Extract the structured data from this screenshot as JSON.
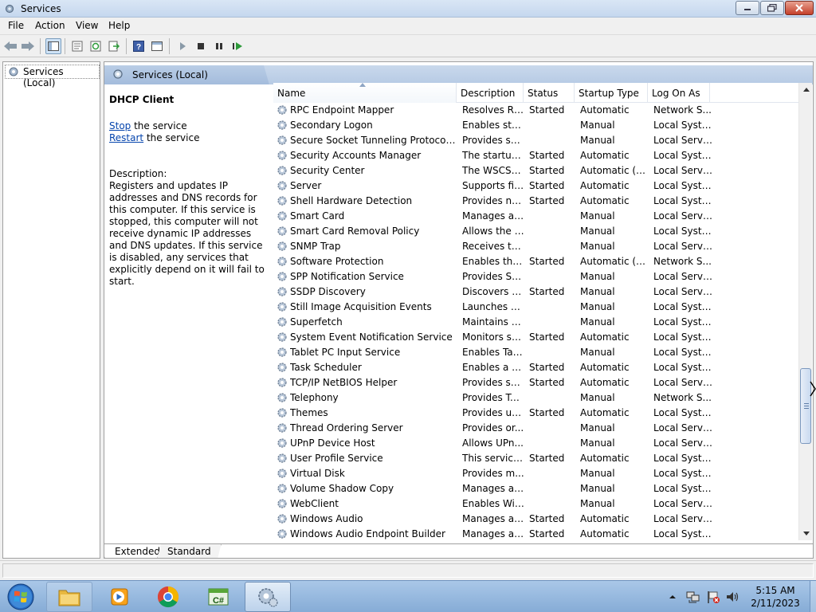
{
  "window": {
    "title": "Services"
  },
  "menu": [
    "File",
    "Action",
    "View",
    "Help"
  ],
  "tree": {
    "root_label": "Services (Local)"
  },
  "pane": {
    "header": "Services (Local)",
    "selected_service": "DHCP Client",
    "stop_link": "Stop",
    "stop_suffix": " the service",
    "restart_link": "Restart",
    "restart_suffix": " the service",
    "description_label": "Description:",
    "description": "Registers and updates IP addresses and DNS records for this computer. If this service is stopped, this computer will not receive dynamic IP addresses and DNS updates. If this service is disabled, any services that explicitly depend on it will fail to start."
  },
  "columns": {
    "name": "Name",
    "description": "Description",
    "status": "Status",
    "startup": "Startup Type",
    "logon": "Log On As"
  },
  "services": [
    {
      "name": "RPC Endpoint Mapper",
      "description": "Resolves RP...",
      "status": "Started",
      "startup": "Automatic",
      "logon": "Network S..."
    },
    {
      "name": "Secondary Logon",
      "description": "Enables star...",
      "status": "",
      "startup": "Manual",
      "logon": "Local Syste..."
    },
    {
      "name": "Secure Socket Tunneling Protocol Ser...",
      "description": "Provides su...",
      "status": "",
      "startup": "Manual",
      "logon": "Local Service"
    },
    {
      "name": "Security Accounts Manager",
      "description": "The startup ...",
      "status": "Started",
      "startup": "Automatic",
      "logon": "Local Syste..."
    },
    {
      "name": "Security Center",
      "description": "The WSCSV...",
      "status": "Started",
      "startup": "Automatic (D...",
      "logon": "Local Service"
    },
    {
      "name": "Server",
      "description": "Supports fil...",
      "status": "Started",
      "startup": "Automatic",
      "logon": "Local Syste..."
    },
    {
      "name": "Shell Hardware Detection",
      "description": "Provides no...",
      "status": "Started",
      "startup": "Automatic",
      "logon": "Local Syste..."
    },
    {
      "name": "Smart Card",
      "description": "Manages ac...",
      "status": "",
      "startup": "Manual",
      "logon": "Local Service"
    },
    {
      "name": "Smart Card Removal Policy",
      "description": "Allows the s...",
      "status": "",
      "startup": "Manual",
      "logon": "Local Syste..."
    },
    {
      "name": "SNMP Trap",
      "description": "Receives tra...",
      "status": "",
      "startup": "Manual",
      "logon": "Local Service"
    },
    {
      "name": "Software Protection",
      "description": "Enables the ...",
      "status": "Started",
      "startup": "Automatic (D...",
      "logon": "Network S..."
    },
    {
      "name": "SPP Notification Service",
      "description": "Provides So...",
      "status": "",
      "startup": "Manual",
      "logon": "Local Service"
    },
    {
      "name": "SSDP Discovery",
      "description": "Discovers n...",
      "status": "Started",
      "startup": "Manual",
      "logon": "Local Service"
    },
    {
      "name": "Still Image Acquisition Events",
      "description": "Launches a...",
      "status": "",
      "startup": "Manual",
      "logon": "Local Syste..."
    },
    {
      "name": "Superfetch",
      "description": "Maintains a...",
      "status": "",
      "startup": "Manual",
      "logon": "Local Syste..."
    },
    {
      "name": "System Event Notification Service",
      "description": "Monitors sy...",
      "status": "Started",
      "startup": "Automatic",
      "logon": "Local Syste..."
    },
    {
      "name": "Tablet PC Input Service",
      "description": "Enables Tab...",
      "status": "",
      "startup": "Manual",
      "logon": "Local Syste..."
    },
    {
      "name": "Task Scheduler",
      "description": "Enables a us...",
      "status": "Started",
      "startup": "Automatic",
      "logon": "Local Syste..."
    },
    {
      "name": "TCP/IP NetBIOS Helper",
      "description": "Provides su...",
      "status": "Started",
      "startup": "Automatic",
      "logon": "Local Service"
    },
    {
      "name": "Telephony",
      "description": "Provides Tel...",
      "status": "",
      "startup": "Manual",
      "logon": "Network S..."
    },
    {
      "name": "Themes",
      "description": "Provides us...",
      "status": "Started",
      "startup": "Automatic",
      "logon": "Local Syste..."
    },
    {
      "name": "Thread Ordering Server",
      "description": "Provides or...",
      "status": "",
      "startup": "Manual",
      "logon": "Local Service"
    },
    {
      "name": "UPnP Device Host",
      "description": "Allows UPn...",
      "status": "",
      "startup": "Manual",
      "logon": "Local Service"
    },
    {
      "name": "User Profile Service",
      "description": "This service ...",
      "status": "Started",
      "startup": "Automatic",
      "logon": "Local Syste..."
    },
    {
      "name": "Virtual Disk",
      "description": "Provides m...",
      "status": "",
      "startup": "Manual",
      "logon": "Local Syste..."
    },
    {
      "name": "Volume Shadow Copy",
      "description": "Manages an...",
      "status": "",
      "startup": "Manual",
      "logon": "Local Syste..."
    },
    {
      "name": "WebClient",
      "description": "Enables Win...",
      "status": "",
      "startup": "Manual",
      "logon": "Local Service"
    },
    {
      "name": "Windows Audio",
      "description": "Manages au...",
      "status": "Started",
      "startup": "Automatic",
      "logon": "Local Service"
    },
    {
      "name": "Windows Audio Endpoint Builder",
      "description": "Manages au...",
      "status": "Started",
      "startup": "Automatic",
      "logon": "Local Syste..."
    }
  ],
  "tabs": [
    "Extended",
    "Standard"
  ],
  "active_tab": "Extended",
  "taskbar": {
    "apps": [
      "file-explorer",
      "media-player",
      "chrome",
      "csharp-editor",
      "services"
    ],
    "active_app": "services"
  },
  "clock": {
    "time": "5:15 AM",
    "date": "2/11/2023"
  },
  "colors": {
    "link": "#0645ad",
    "header": "#a4bcdc",
    "taskbar": "#86acd6"
  }
}
